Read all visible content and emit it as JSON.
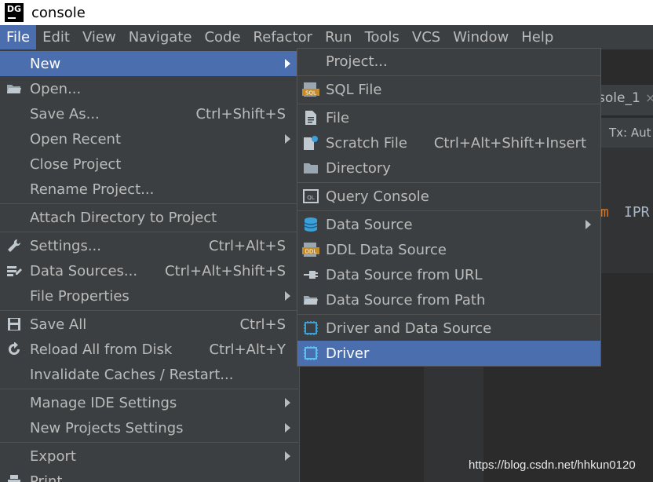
{
  "window": {
    "app_icon": "DG",
    "title": "console"
  },
  "menubar": [
    "File",
    "Edit",
    "View",
    "Navigate",
    "Code",
    "Refactor",
    "Run",
    "Tools",
    "VCS",
    "Window",
    "Help"
  ],
  "editor": {
    "tab_label": "sole_1",
    "tab_close": "×",
    "tx_label": "Tx: Aut",
    "code_keyword": "m",
    "code_text": "IPR"
  },
  "file_menu": {
    "items": [
      {
        "label": "New",
        "icon": "none",
        "shortcut": "",
        "submenu": true
      },
      {
        "label": "Open...",
        "icon": "folder-icon",
        "shortcut": "",
        "submenu": false
      },
      {
        "label": "Save As...",
        "icon": "none",
        "shortcut": "Ctrl+Shift+S",
        "submenu": false
      },
      {
        "label": "Open Recent",
        "icon": "none",
        "shortcut": "",
        "submenu": true
      },
      {
        "label": "Close Project",
        "icon": "none",
        "shortcut": "",
        "submenu": false
      },
      {
        "label": "Rename Project...",
        "icon": "none",
        "shortcut": "",
        "submenu": false
      },
      {
        "label": "Attach Directory to Project",
        "icon": "none",
        "shortcut": "",
        "submenu": false
      },
      {
        "label": "Settings...",
        "icon": "wrench-icon",
        "shortcut": "Ctrl+Alt+S",
        "submenu": false
      },
      {
        "label": "Data Sources...",
        "icon": "data-sources-icon",
        "shortcut": "Ctrl+Alt+Shift+S",
        "submenu": false
      },
      {
        "label": "File Properties",
        "icon": "none",
        "shortcut": "",
        "submenu": true
      },
      {
        "label": "Save All",
        "icon": "save-icon",
        "shortcut": "Ctrl+S",
        "submenu": false
      },
      {
        "label": "Reload All from Disk",
        "icon": "reload-icon",
        "shortcut": "Ctrl+Alt+Y",
        "submenu": false
      },
      {
        "label": "Invalidate Caches / Restart...",
        "icon": "none",
        "shortcut": "",
        "submenu": false
      },
      {
        "label": "Manage IDE Settings",
        "icon": "none",
        "shortcut": "",
        "submenu": true
      },
      {
        "label": "New Projects Settings",
        "icon": "none",
        "shortcut": "",
        "submenu": true
      },
      {
        "label": "Export",
        "icon": "none",
        "shortcut": "",
        "submenu": true
      },
      {
        "label": "Print...",
        "icon": "print-icon",
        "shortcut": "",
        "submenu": false
      }
    ]
  },
  "new_submenu": {
    "items": [
      {
        "label": "Project...",
        "icon": "none",
        "shortcut": "",
        "submenu": false
      },
      {
        "label": "SQL File",
        "icon": "sql-file-icon",
        "shortcut": "",
        "submenu": false
      },
      {
        "label": "File",
        "icon": "file-icon",
        "shortcut": "",
        "submenu": false
      },
      {
        "label": "Scratch File",
        "icon": "scratch-file-icon",
        "shortcut": "Ctrl+Alt+Shift+Insert",
        "submenu": false
      },
      {
        "label": "Directory",
        "icon": "folder-icon",
        "shortcut": "",
        "submenu": false
      },
      {
        "label": "Query Console",
        "icon": "query-console-icon",
        "shortcut": "",
        "submenu": false
      },
      {
        "label": "Data Source",
        "icon": "database-icon",
        "shortcut": "",
        "submenu": true
      },
      {
        "label": "DDL Data Source",
        "icon": "ddl-icon",
        "shortcut": "",
        "submenu": false
      },
      {
        "label": "Data Source from URL",
        "icon": "url-plug-icon",
        "shortcut": "",
        "submenu": false
      },
      {
        "label": "Data Source from Path",
        "icon": "folder-icon",
        "shortcut": "",
        "submenu": false
      },
      {
        "label": "Driver and Data Source",
        "icon": "driver-icon",
        "shortcut": "",
        "submenu": false
      },
      {
        "label": "Driver",
        "icon": "driver-icon",
        "shortcut": "",
        "submenu": false
      }
    ]
  },
  "watermark": "https://blog.csdn.net/hhkun0120",
  "colors": {
    "menu_bg": "#3c3f41",
    "highlight": "#4b6eaf",
    "text": "#bbbbbb"
  }
}
